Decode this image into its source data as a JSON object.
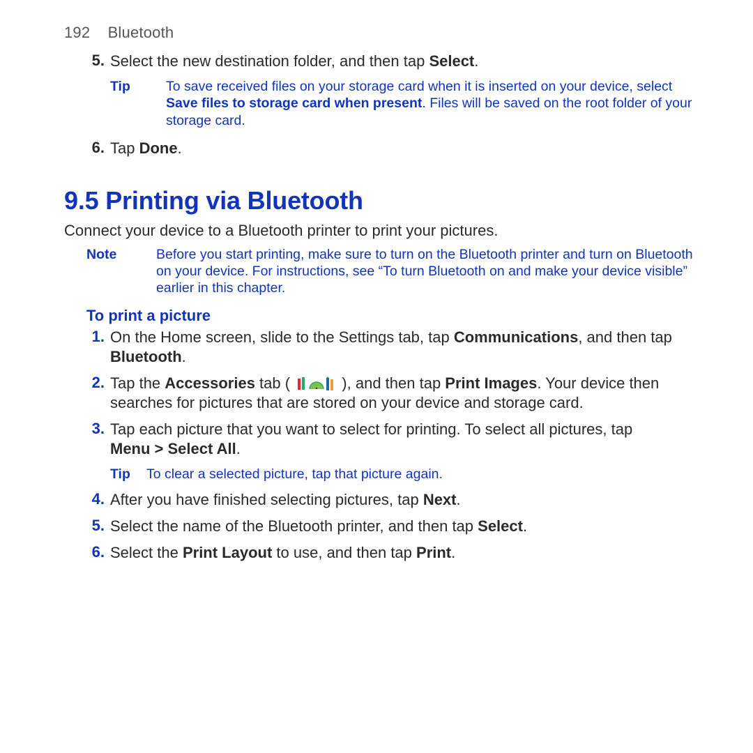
{
  "header": {
    "page_num": "192",
    "section": "Bluetooth"
  },
  "topList": {
    "item5": {
      "num": "5.",
      "pre": "Select the new destination folder, and then tap ",
      "bold": "Select",
      "post": "."
    },
    "tip": {
      "label": "Tip",
      "t1": "To save received files on your storage card when it is inserted on your device, select ",
      "bold": "Save files to storage card when present",
      "t2": ". Files will be saved on the root folder of your storage card."
    },
    "item6": {
      "num": "6.",
      "pre": "Tap ",
      "bold": "Done",
      "post": "."
    }
  },
  "h2": "9.5 Printing via Bluetooth",
  "intro": "Connect your device to a Bluetooth printer to print your pictures.",
  "note": {
    "label": "Note",
    "text": "Before you start printing, make sure to turn on the Bluetooth printer and turn on Bluetooth on your device. For instructions, see “To turn Bluetooth on and make your device visible” earlier in this chapter."
  },
  "subhead": "To print a picture",
  "steps": {
    "s1": {
      "num": "1.",
      "a": "On the Home screen, slide to the Settings tab, tap ",
      "b1": "Communications",
      "b": ", and then tap ",
      "b2": "Bluetooth",
      "c": "."
    },
    "s2": {
      "num": "2.",
      "a": "Tap the ",
      "b1": "Accessories",
      "b": " tab ( ",
      "c": " ), and then tap ",
      "b2": "Print Images",
      "d": ". Your device then searches for pictures that are stored on your device and storage card."
    },
    "s3": {
      "num": "3.",
      "a": "Tap each picture that you want to select for printing. To select all pictures, tap ",
      "b1": "Menu > Select All",
      "b": "."
    },
    "tip": {
      "label": "Tip",
      "text": "To clear a selected picture, tap that picture again."
    },
    "s4": {
      "num": "4.",
      "a": "After you have finished selecting pictures, tap ",
      "b1": "Next",
      "b": "."
    },
    "s5": {
      "num": "5.",
      "a": "Select the name of the Bluetooth printer, and then tap ",
      "b1": "Select",
      "b": "."
    },
    "s6": {
      "num": "6.",
      "a": "Select the ",
      "b1": "Print Layout",
      "b": " to use, and then tap ",
      "b2": "Print",
      "c": "."
    }
  }
}
